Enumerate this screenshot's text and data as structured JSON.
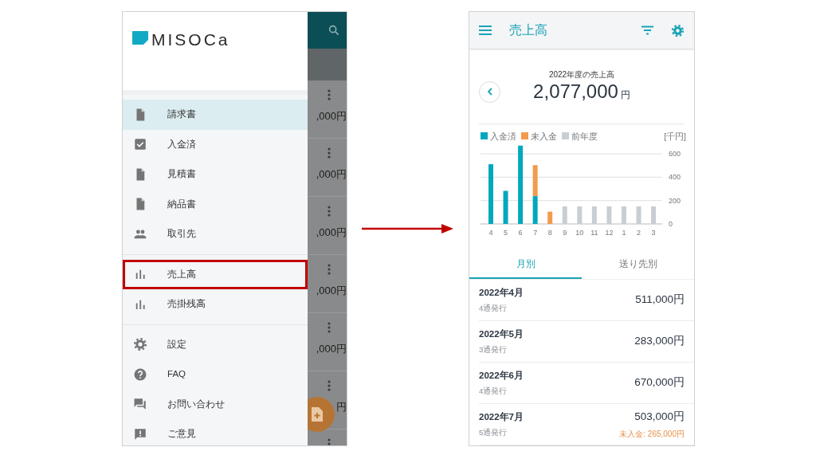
{
  "left_screen": {
    "logo": {
      "text": "MISOCa"
    },
    "drawer": {
      "groups": [
        {
          "items": [
            {
              "label": "請求書",
              "kind": "document",
              "selected": true,
              "highlighted": false
            },
            {
              "label": "入金済",
              "kind": "check",
              "selected": false,
              "highlighted": false
            },
            {
              "label": "見積書",
              "kind": "document",
              "selected": false,
              "highlighted": false
            },
            {
              "label": "納品書",
              "kind": "document",
              "selected": false,
              "highlighted": false
            },
            {
              "label": "取引先",
              "kind": "people",
              "selected": false,
              "highlighted": false
            }
          ]
        },
        {
          "items": [
            {
              "label": "売上高",
              "kind": "chart",
              "selected": false,
              "highlighted": true
            },
            {
              "label": "売掛残高",
              "kind": "chart",
              "selected": false,
              "highlighted": false
            }
          ]
        },
        {
          "items": [
            {
              "label": "設定",
              "kind": "gear",
              "selected": false,
              "highlighted": false
            },
            {
              "label": "FAQ",
              "kind": "help",
              "selected": false,
              "highlighted": false
            },
            {
              "label": "お問い合わせ",
              "kind": "chat",
              "selected": false,
              "highlighted": false
            },
            {
              "label": "ご意見",
              "kind": "feedback",
              "selected": false,
              "highlighted": false
            }
          ]
        }
      ]
    },
    "background_list": {
      "rows": [
        {
          "amount": ",000円"
        },
        {
          "amount": ",000円"
        },
        {
          "amount": ",000円"
        },
        {
          "amount": ",000円"
        },
        {
          "amount": ",000円"
        },
        {
          "amount": "円"
        }
      ]
    }
  },
  "right_screen": {
    "app_bar": {
      "title": "売上高"
    },
    "summary": {
      "caption": "2022年度の売上高",
      "amount": "2,077,000",
      "unit": "円"
    },
    "chart": {
      "unit_label": "[千円]",
      "chart_data": {
        "type": "bar",
        "stacked": true,
        "categories": [
          "4",
          "5",
          "6",
          "7",
          "8",
          "9",
          "10",
          "11",
          "12",
          "1",
          "2",
          "3"
        ],
        "series": [
          {
            "name": "入金済",
            "color": "#00a8bd",
            "values": [
              511,
              283,
              670,
              238,
              null,
              null,
              null,
              null,
              null,
              null,
              null,
              null
            ]
          },
          {
            "name": "未入金",
            "color": "#f39a4c",
            "values": [
              null,
              null,
              null,
              265,
              105,
              null,
              null,
              null,
              null,
              null,
              null,
              null
            ]
          },
          {
            "name": "前年度",
            "color": "#c9cdd4",
            "values": [
              null,
              null,
              null,
              null,
              null,
              150,
              150,
              150,
              150,
              150,
              150,
              150
            ]
          }
        ],
        "ylim": [
          0,
          680
        ],
        "yticks": [
          0,
          200,
          400,
          600
        ],
        "grid": true,
        "legend": "top"
      }
    },
    "tabs": [
      {
        "label": "月別",
        "selected": true
      },
      {
        "label": "送り先別",
        "selected": false
      }
    ],
    "rows": [
      {
        "month": "2022年4月",
        "count": "4通発行",
        "amount": "511,000円"
      },
      {
        "month": "2022年5月",
        "count": "3通発行",
        "amount": "283,000円"
      },
      {
        "month": "2022年6月",
        "count": "4通発行",
        "amount": "670,000円"
      },
      {
        "month": "2022年7月",
        "count": "5通発行",
        "amount": "503,000円",
        "unpaid": "未入金: 265,000円"
      }
    ]
  }
}
